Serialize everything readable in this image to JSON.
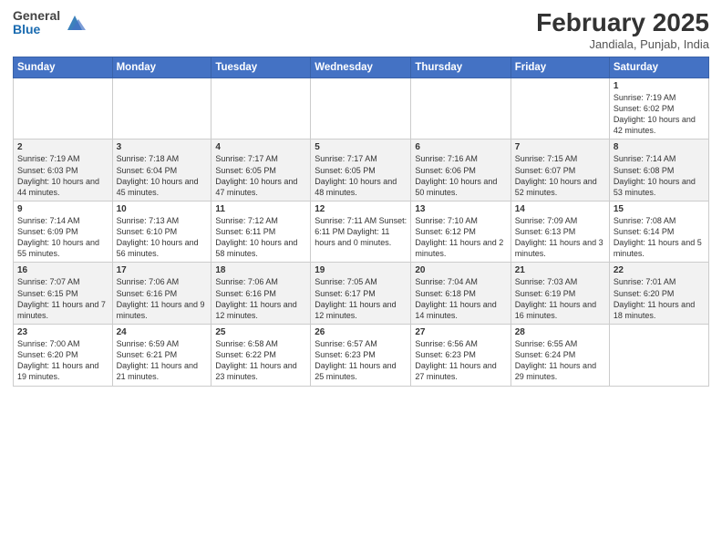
{
  "header": {
    "logo_general": "General",
    "logo_blue": "Blue",
    "month_year": "February 2025",
    "location": "Jandiala, Punjab, India"
  },
  "weekdays": [
    "Sunday",
    "Monday",
    "Tuesday",
    "Wednesday",
    "Thursday",
    "Friday",
    "Saturday"
  ],
  "weeks": [
    [
      {
        "day": "",
        "info": ""
      },
      {
        "day": "",
        "info": ""
      },
      {
        "day": "",
        "info": ""
      },
      {
        "day": "",
        "info": ""
      },
      {
        "day": "",
        "info": ""
      },
      {
        "day": "",
        "info": ""
      },
      {
        "day": "1",
        "info": "Sunrise: 7:19 AM\nSunset: 6:02 PM\nDaylight: 10 hours and 42 minutes."
      }
    ],
    [
      {
        "day": "2",
        "info": "Sunrise: 7:19 AM\nSunset: 6:03 PM\nDaylight: 10 hours and 44 minutes."
      },
      {
        "day": "3",
        "info": "Sunrise: 7:18 AM\nSunset: 6:04 PM\nDaylight: 10 hours and 45 minutes."
      },
      {
        "day": "4",
        "info": "Sunrise: 7:17 AM\nSunset: 6:05 PM\nDaylight: 10 hours and 47 minutes."
      },
      {
        "day": "5",
        "info": "Sunrise: 7:17 AM\nSunset: 6:05 PM\nDaylight: 10 hours and 48 minutes."
      },
      {
        "day": "6",
        "info": "Sunrise: 7:16 AM\nSunset: 6:06 PM\nDaylight: 10 hours and 50 minutes."
      },
      {
        "day": "7",
        "info": "Sunrise: 7:15 AM\nSunset: 6:07 PM\nDaylight: 10 hours and 52 minutes."
      },
      {
        "day": "8",
        "info": "Sunrise: 7:14 AM\nSunset: 6:08 PM\nDaylight: 10 hours and 53 minutes."
      }
    ],
    [
      {
        "day": "9",
        "info": "Sunrise: 7:14 AM\nSunset: 6:09 PM\nDaylight: 10 hours and 55 minutes."
      },
      {
        "day": "10",
        "info": "Sunrise: 7:13 AM\nSunset: 6:10 PM\nDaylight: 10 hours and 56 minutes."
      },
      {
        "day": "11",
        "info": "Sunrise: 7:12 AM\nSunset: 6:11 PM\nDaylight: 10 hours and 58 minutes."
      },
      {
        "day": "12",
        "info": "Sunrise: 7:11 AM\nSunset: 6:11 PM\nDaylight: 11 hours and 0 minutes."
      },
      {
        "day": "13",
        "info": "Sunrise: 7:10 AM\nSunset: 6:12 PM\nDaylight: 11 hours and 2 minutes."
      },
      {
        "day": "14",
        "info": "Sunrise: 7:09 AM\nSunset: 6:13 PM\nDaylight: 11 hours and 3 minutes."
      },
      {
        "day": "15",
        "info": "Sunrise: 7:08 AM\nSunset: 6:14 PM\nDaylight: 11 hours and 5 minutes."
      }
    ],
    [
      {
        "day": "16",
        "info": "Sunrise: 7:07 AM\nSunset: 6:15 PM\nDaylight: 11 hours and 7 minutes."
      },
      {
        "day": "17",
        "info": "Sunrise: 7:06 AM\nSunset: 6:16 PM\nDaylight: 11 hours and 9 minutes."
      },
      {
        "day": "18",
        "info": "Sunrise: 7:06 AM\nSunset: 6:16 PM\nDaylight: 11 hours and 12 minutes."
      },
      {
        "day": "19",
        "info": "Sunrise: 7:05 AM\nSunset: 6:17 PM\nDaylight: 11 hours and 12 minutes."
      },
      {
        "day": "20",
        "info": "Sunrise: 7:04 AM\nSunset: 6:18 PM\nDaylight: 11 hours and 14 minutes."
      },
      {
        "day": "21",
        "info": "Sunrise: 7:03 AM\nSunset: 6:19 PM\nDaylight: 11 hours and 16 minutes."
      },
      {
        "day": "22",
        "info": "Sunrise: 7:01 AM\nSunset: 6:20 PM\nDaylight: 11 hours and 18 minutes."
      }
    ],
    [
      {
        "day": "23",
        "info": "Sunrise: 7:00 AM\nSunset: 6:20 PM\nDaylight: 11 hours and 19 minutes."
      },
      {
        "day": "24",
        "info": "Sunrise: 6:59 AM\nSunset: 6:21 PM\nDaylight: 11 hours and 21 minutes."
      },
      {
        "day": "25",
        "info": "Sunrise: 6:58 AM\nSunset: 6:22 PM\nDaylight: 11 hours and 23 minutes."
      },
      {
        "day": "26",
        "info": "Sunrise: 6:57 AM\nSunset: 6:23 PM\nDaylight: 11 hours and 25 minutes."
      },
      {
        "day": "27",
        "info": "Sunrise: 6:56 AM\nSunset: 6:23 PM\nDaylight: 11 hours and 27 minutes."
      },
      {
        "day": "28",
        "info": "Sunrise: 6:55 AM\nSunset: 6:24 PM\nDaylight: 11 hours and 29 minutes."
      },
      {
        "day": "",
        "info": ""
      }
    ]
  ]
}
